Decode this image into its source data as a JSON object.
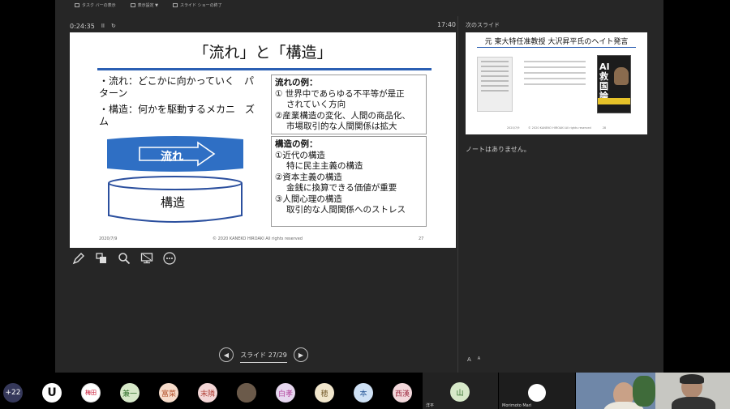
{
  "toolbar": {
    "taskbar": "タスク バーの表示",
    "display_settings": "表示設定 ▼",
    "end_show": "スライド ショーの終了"
  },
  "timer": {
    "elapsed": "0:24:35",
    "pause": "II",
    "reset": "↻",
    "clock": "17:40"
  },
  "slide": {
    "title": "「流れ」と「構造」",
    "bullets": [
      "・流れ：どこかに向かっていく　パターン",
      "・構造：何かを駆動するメカニ　ズム"
    ],
    "flow_label": "流れ",
    "structure_label": "構造",
    "flow_box": {
      "heading": "流れの例：",
      "lines": [
        "① 世界中であらゆる不平等が是正",
        "されていく方向",
        "②産業構造の変化、人間の商品化、",
        "市場取引的な人間関係は拡大"
      ]
    },
    "structure_box": {
      "heading": "構造の例：",
      "lines": [
        "①近代の構造",
        "特に民主主義の構造",
        "②資本主義の構造",
        "金銭に換算できる価値が重要",
        "③人間心理の構造",
        "取引的な人間関係へのストレス"
      ]
    },
    "footer": {
      "date": "2020/7/9",
      "copyright": "© 2020 KANEKO HIROAKI All rights reserved",
      "page": "27"
    }
  },
  "tools": [
    "pen-icon",
    "slides-grid-icon",
    "zoom-icon",
    "screen-icon",
    "more-icon"
  ],
  "nav": {
    "prev": "◀",
    "next": "▶",
    "counter": "スライド 27/29"
  },
  "next_panel": {
    "label": "次のスライド",
    "title": "元 東大特任准教授 大沢昇平氏のヘイト発言",
    "book_text": "AI救国論",
    "footer": "2020/7/9　　　© 2020 KANEKO HIROAKI All rights reserved　　　　28"
  },
  "notes": "ノートはありません。",
  "font_buttons": [
    "A",
    "A"
  ],
  "participants": {
    "more_count": "+22",
    "avatars": [
      {
        "label": "U",
        "style": "pa-logo",
        "name": "logo-avatar"
      },
      {
        "label": "梅田",
        "style": "pa-red",
        "name": "stamp-avatar"
      },
      {
        "label": "",
        "style": "pa-photo",
        "name": "photo-avatar"
      },
      {
        "label": "兼一",
        "style": "pa-green",
        "name": "avatar"
      },
      {
        "label": "富菜",
        "style": "pa-peach",
        "name": "avatar"
      },
      {
        "label": "末隣",
        "style": "pa-pink",
        "name": "avatar"
      },
      {
        "label": "",
        "style": "pa-photo",
        "name": "photo-avatar"
      },
      {
        "label": "白孝",
        "style": "pa-lilac",
        "name": "avatar"
      },
      {
        "label": "穂",
        "style": "pa-cream",
        "name": "avatar"
      },
      {
        "label": "本",
        "style": "pa-blue",
        "name": "avatar"
      },
      {
        "label": "西漢",
        "style": "pa-rose",
        "name": "avatar"
      }
    ],
    "tiles": [
      {
        "avatar": "山",
        "name": "洋平"
      },
      {
        "name": "Morimoto Mari"
      }
    ]
  }
}
